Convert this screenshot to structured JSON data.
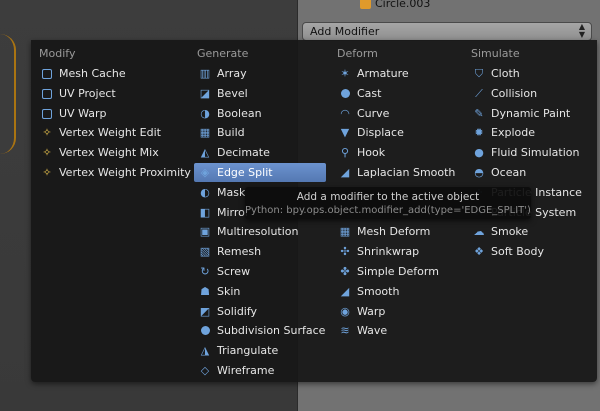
{
  "header": {
    "object_name": "Circle.003",
    "add_modifier_label": "Add Modifier"
  },
  "menu": {
    "columns": [
      {
        "title": "Modify",
        "items": [
          {
            "label": "Mesh Cache",
            "icon": "mesh-cache-icon"
          },
          {
            "label": "UV Project",
            "icon": "uv-project-icon"
          },
          {
            "label": "UV Warp",
            "icon": "uv-warp-icon"
          },
          {
            "label": "Vertex Weight Edit",
            "icon": "vertex-weight-icon"
          },
          {
            "label": "Vertex Weight Mix",
            "icon": "vertex-weight-icon"
          },
          {
            "label": "Vertex Weight Proximity",
            "icon": "vertex-weight-icon"
          }
        ]
      },
      {
        "title": "Generate",
        "items": [
          {
            "label": "Array",
            "icon": "array-icon"
          },
          {
            "label": "Bevel",
            "icon": "bevel-icon"
          },
          {
            "label": "Boolean",
            "icon": "boolean-icon"
          },
          {
            "label": "Build",
            "icon": "build-icon"
          },
          {
            "label": "Decimate",
            "icon": "decimate-icon"
          },
          {
            "label": "Edge Split",
            "icon": "edge-split-icon",
            "active": true
          },
          {
            "label": "Mask",
            "icon": "mask-icon"
          },
          {
            "label": "Mirror",
            "icon": "mirror-icon"
          },
          {
            "label": "Multiresolution",
            "icon": "multires-icon"
          },
          {
            "label": "Remesh",
            "icon": "remesh-icon"
          },
          {
            "label": "Screw",
            "icon": "screw-icon"
          },
          {
            "label": "Skin",
            "icon": "skin-icon"
          },
          {
            "label": "Solidify",
            "icon": "solidify-icon"
          },
          {
            "label": "Subdivision Surface",
            "icon": "subsurf-icon"
          },
          {
            "label": "Triangulate",
            "icon": "triangulate-icon"
          },
          {
            "label": "Wireframe",
            "icon": "wireframe-icon"
          }
        ]
      },
      {
        "title": "Deform",
        "items": [
          {
            "label": "Armature",
            "icon": "armature-icon"
          },
          {
            "label": "Cast",
            "icon": "cast-icon"
          },
          {
            "label": "Curve",
            "icon": "curve-icon"
          },
          {
            "label": "Displace",
            "icon": "displace-icon"
          },
          {
            "label": "Hook",
            "icon": "hook-icon"
          },
          {
            "label": "Laplacian Smooth",
            "icon": "smooth-icon"
          },
          {
            "label": "",
            "icon": "hidden"
          },
          {
            "label": "",
            "icon": "hidden"
          },
          {
            "label": "Mesh Deform",
            "icon": "mesh-deform-icon"
          },
          {
            "label": "Shrinkwrap",
            "icon": "shrinkwrap-icon"
          },
          {
            "label": "Simple Deform",
            "icon": "simple-deform-icon"
          },
          {
            "label": "Smooth",
            "icon": "smooth-icon"
          },
          {
            "label": "Warp",
            "icon": "warp-icon"
          },
          {
            "label": "Wave",
            "icon": "wave-icon"
          }
        ]
      },
      {
        "title": "Simulate",
        "items": [
          {
            "label": "Cloth",
            "icon": "cloth-icon"
          },
          {
            "label": "Collision",
            "icon": "collision-icon"
          },
          {
            "label": "Dynamic Paint",
            "icon": "dynamic-paint-icon"
          },
          {
            "label": "Explode",
            "icon": "explode-icon"
          },
          {
            "label": "Fluid Simulation",
            "icon": "fluid-icon"
          },
          {
            "label": "Ocean",
            "icon": "ocean-icon"
          },
          {
            "label": "Particle Instance",
            "icon": "particle-instance-icon"
          },
          {
            "label": "Particle System",
            "icon": "particle-system-icon"
          },
          {
            "label": "Smoke",
            "icon": "smoke-icon"
          },
          {
            "label": "Soft Body",
            "icon": "soft-body-icon"
          }
        ]
      }
    ]
  },
  "tooltip": {
    "description": "Add a modifier to the active object",
    "python": "Python: bpy.ops.object.modifier_add(type='EDGE_SPLIT')"
  }
}
